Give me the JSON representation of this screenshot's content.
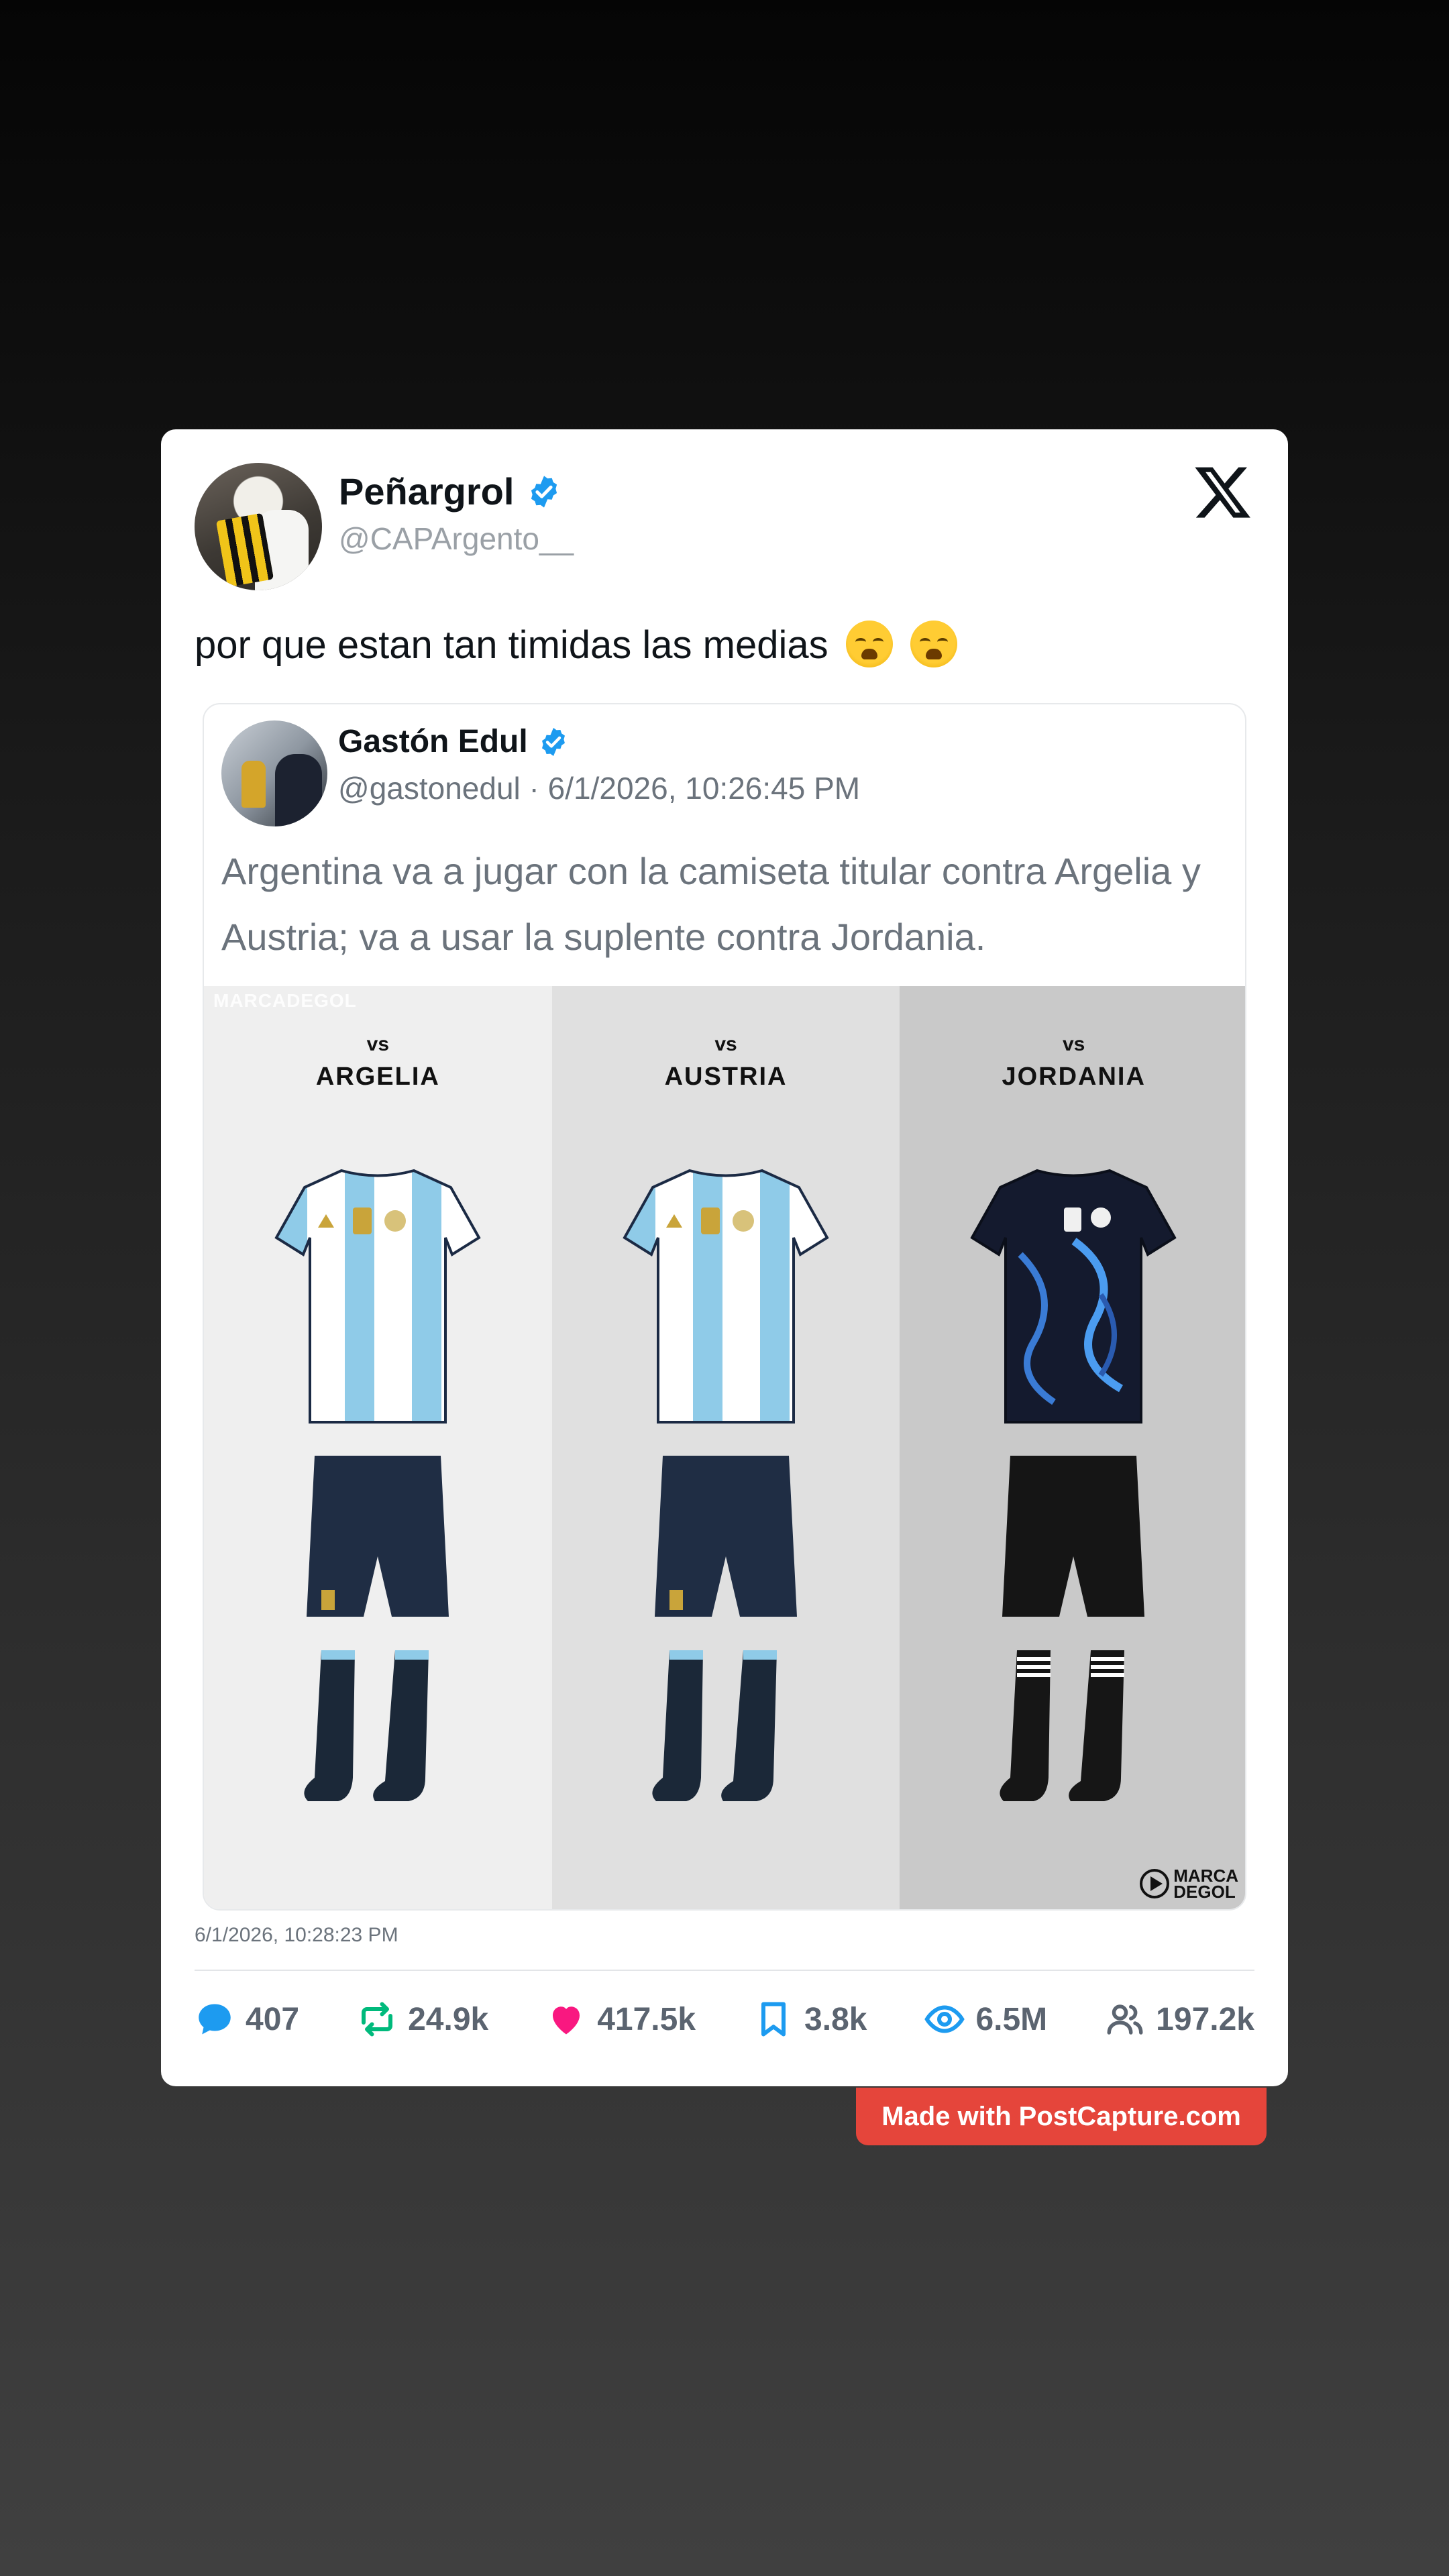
{
  "tweet": {
    "author_name": "Peñargrol",
    "author_handle": "@CAPArgento__",
    "text": "por que estan tan timidas las medias",
    "emojis": [
      "loudly-crying-face-icon",
      "loudly-crying-face-icon"
    ],
    "timestamp": "6/1/2026, 10:28:23 PM"
  },
  "quoted": {
    "author_name": "Gastón Edul",
    "meta": "@gastonedul · 6/1/2026, 10:26:45 PM",
    "text": "Argentina va a jugar con la camiseta titular contra Argelia y Austria; va a usar la suplente contra Jordania.",
    "image": {
      "watermark": "MARCADEGOL",
      "brand_logo_text": [
        "MARCA",
        "DEGOL"
      ],
      "columns": [
        {
          "vs": "vs",
          "team": "ARGELIA",
          "kit": "home"
        },
        {
          "vs": "vs",
          "team": "AUSTRIA",
          "kit": "home"
        },
        {
          "vs": "vs",
          "team": "JORDANIA",
          "kit": "away"
        }
      ]
    }
  },
  "stats": {
    "replies": "407",
    "reposts": "24.9k",
    "likes": "417.5k",
    "bookmarks": "3.8k",
    "views": "6.5M",
    "followers": "197.2k"
  },
  "colors": {
    "verified": "#1d9bf0",
    "reply": "#1d9bf0",
    "repost": "#00ba7c",
    "like": "#f91880",
    "bookmark": "#1d9bf0",
    "views": "#1d9bf0",
    "watermark_button": "#e5453b"
  },
  "footer": {
    "made_with": "Made with PostCapture.com"
  }
}
